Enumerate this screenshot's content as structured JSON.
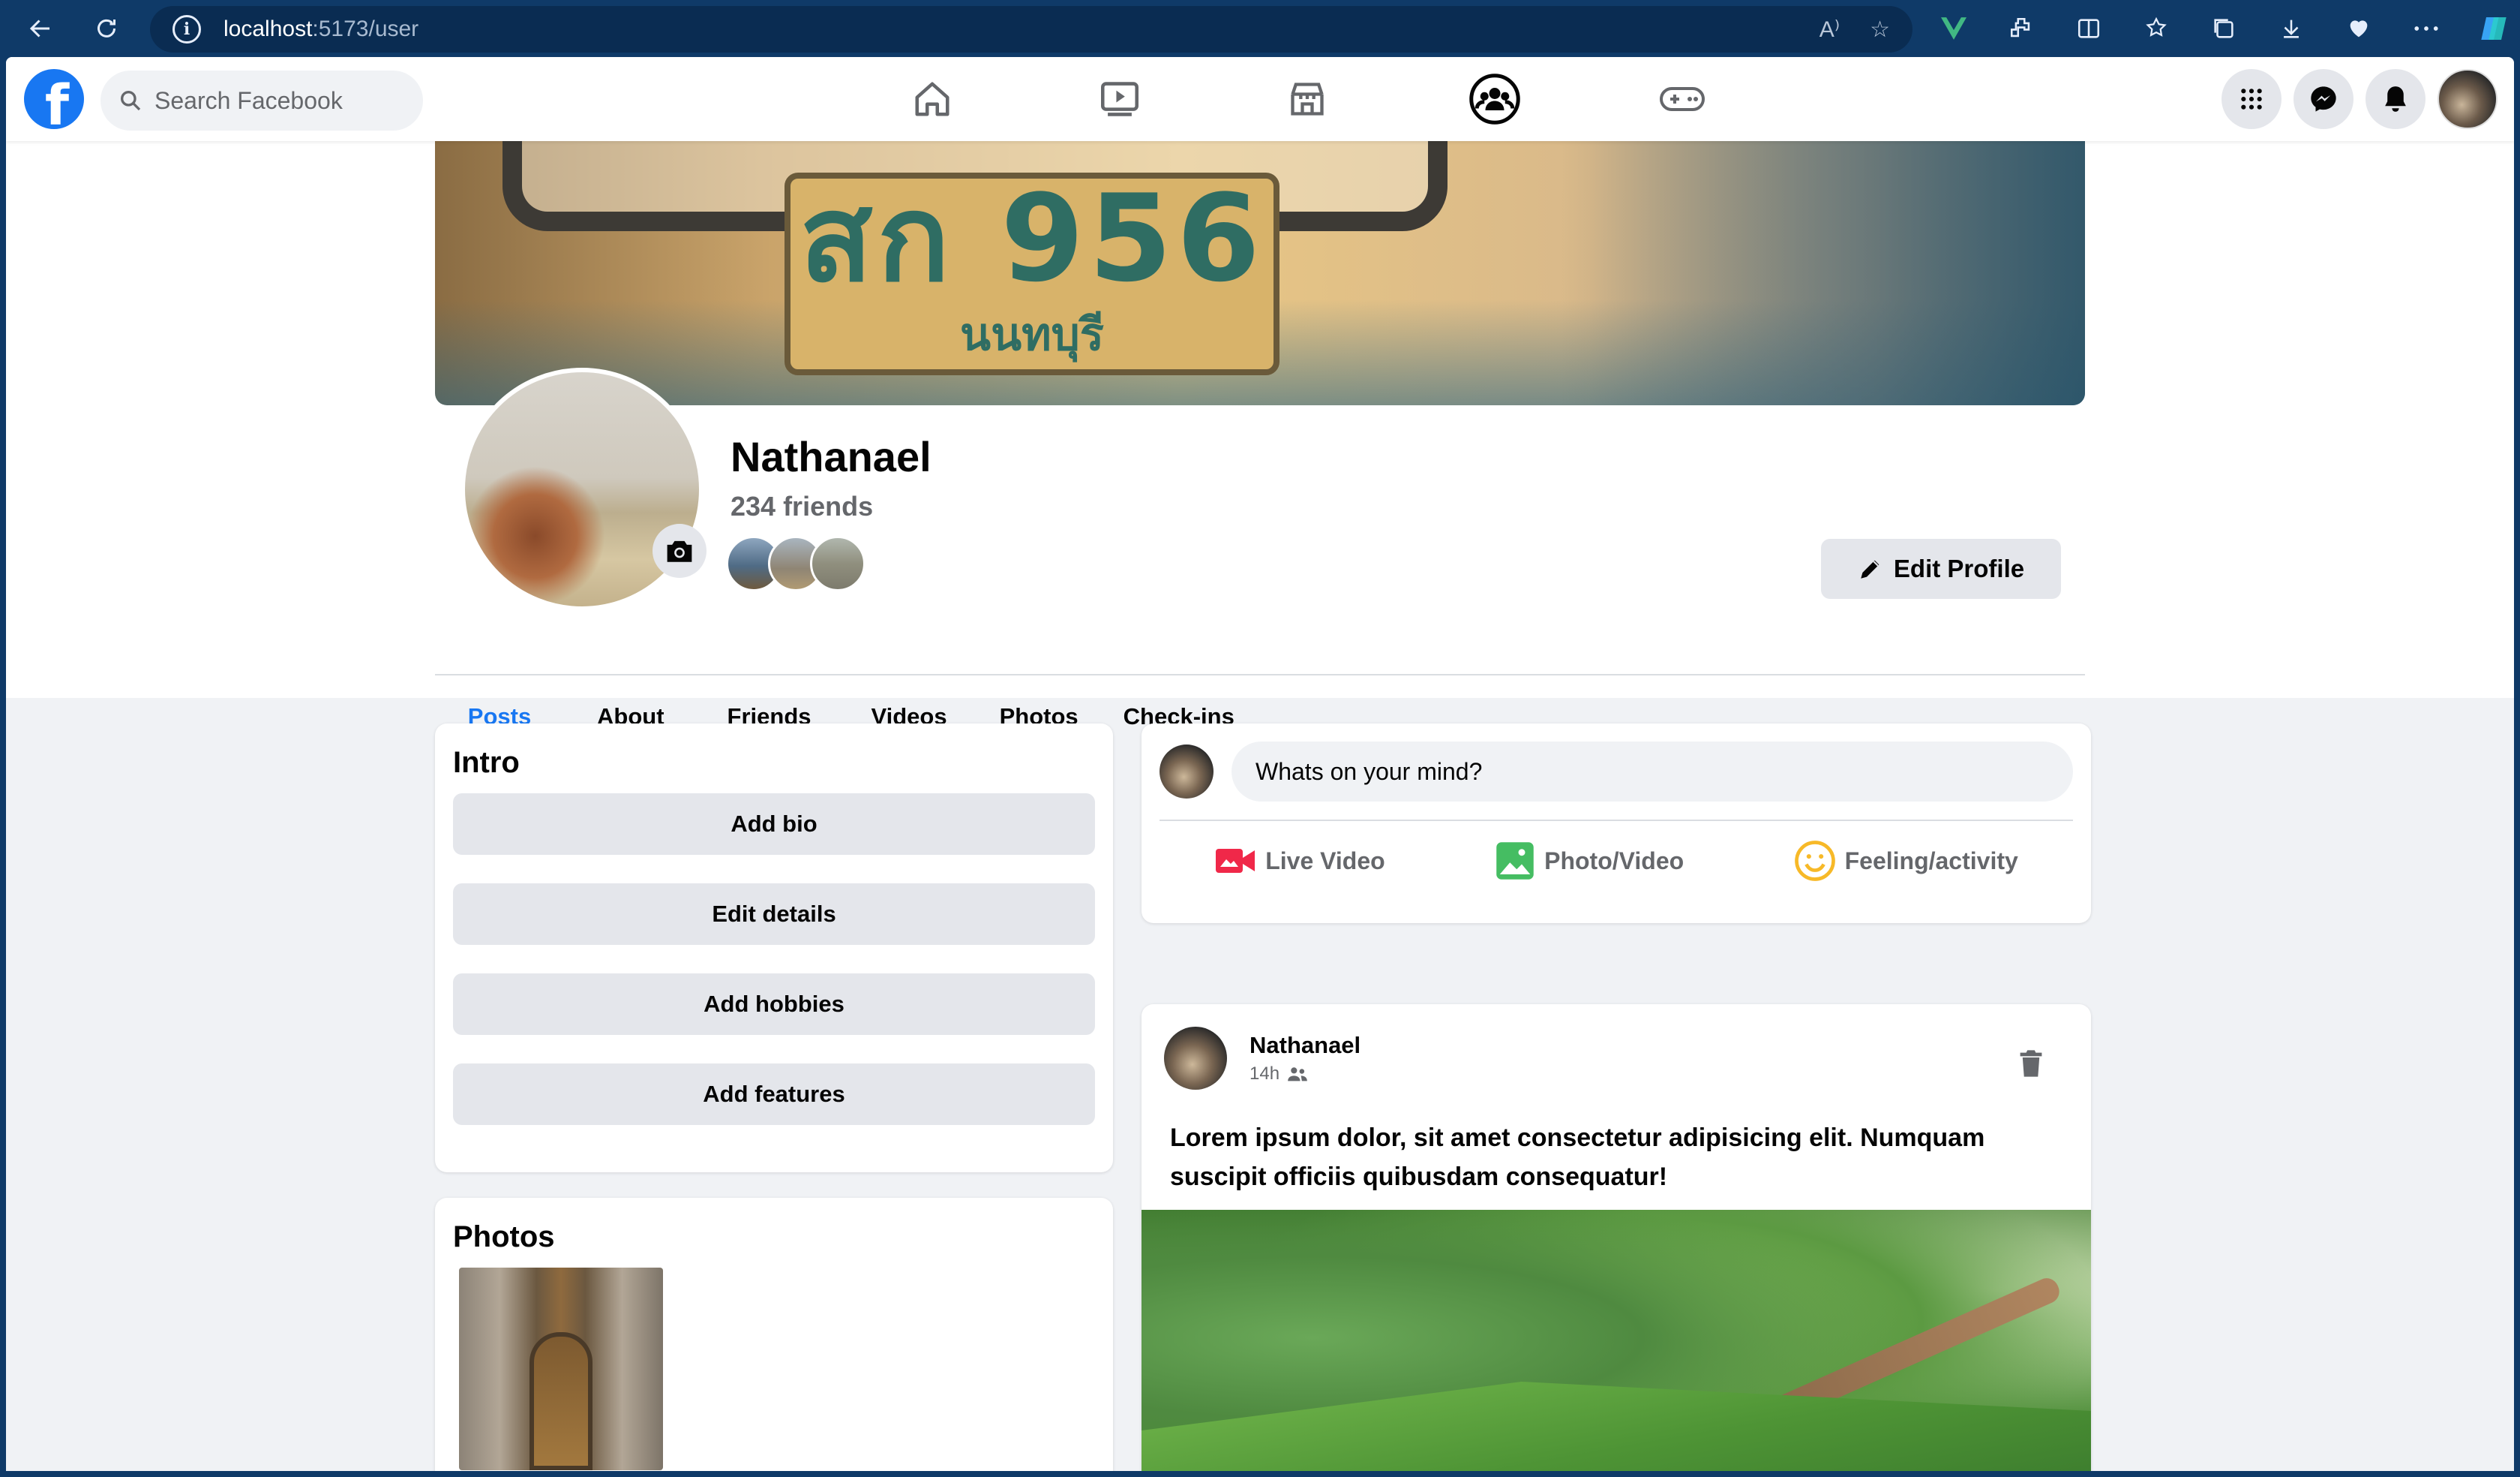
{
  "browser": {
    "url_host": "localhost",
    "url_path": ":5173/user"
  },
  "topnav": {
    "logo_letter": "f",
    "search_placeholder": "Search Facebook"
  },
  "profile": {
    "name": "Nathanael",
    "friends_count": "234 friends",
    "edit_button": "Edit Profile",
    "cover_plate_text": "สก 956",
    "cover_plate_subtext": "นนทบุรี"
  },
  "tabs": [
    "Posts",
    "About",
    "Friends",
    "Videos",
    "Photos",
    "Check-ins"
  ],
  "intro": {
    "title": "Intro",
    "buttons": [
      "Add bio",
      "Edit details",
      "Add hobbies",
      "Add features"
    ]
  },
  "photos": {
    "title": "Photos"
  },
  "composer": {
    "placeholder": "Whats on your mind?",
    "actions": {
      "live": "Live Video",
      "photo": "Photo/Video",
      "feeling": "Feeling/activity"
    }
  },
  "post": {
    "author": "Nathanael",
    "time": "14h",
    "text": "Lorem ipsum dolor, sit amet consectetur adipisicing elit. Numquam suscipit officiis quibusdam consequatur!"
  },
  "colors": {
    "brand": "#1877f2",
    "browser_chrome": "#0f3a68",
    "page_bg": "#f0f2f5",
    "button_bg": "#e4e6eb",
    "live_red": "#f02849",
    "photo_green": "#45bd62",
    "feeling_yellow": "#f7b928"
  }
}
